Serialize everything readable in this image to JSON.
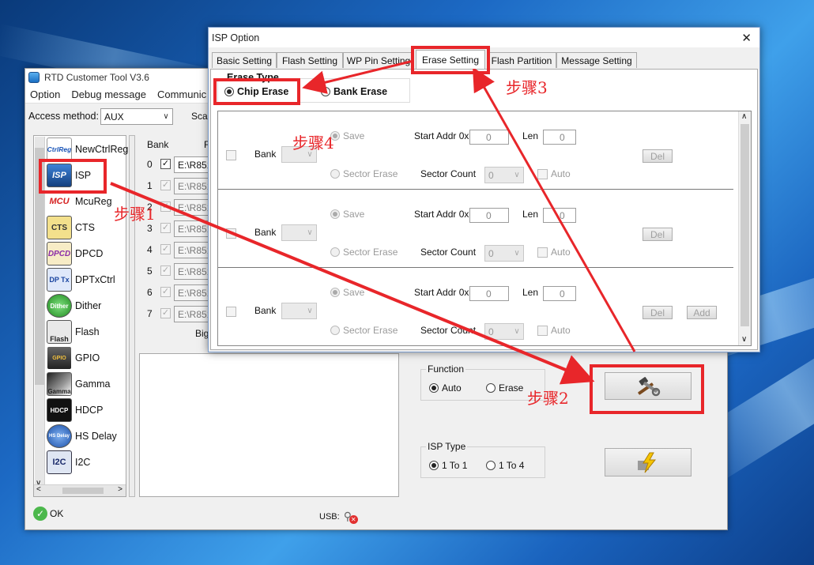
{
  "desktop": {
    "accent": "#1c69c4"
  },
  "main": {
    "title": "RTD Customer Tool V3.6",
    "menu": [
      "Option",
      "Debug message",
      "Communic"
    ],
    "access_label": "Access method:",
    "access_value": "AUX",
    "scan_label": "Sca",
    "sidebar": [
      {
        "label": "NewCtrlReg",
        "icon": "CtrlReg"
      },
      {
        "label": "ISP",
        "icon": "ISP"
      },
      {
        "label": "McuReg",
        "icon": "MCU"
      },
      {
        "label": "CTS",
        "icon": "CTS"
      },
      {
        "label": "DPCD",
        "icon": "DPCD"
      },
      {
        "label": "DPTxCtrl",
        "icon": "DP Tx"
      },
      {
        "label": "Dither",
        "icon": "Dither"
      },
      {
        "label": "Flash",
        "icon": "Flash"
      },
      {
        "label": "GPIO",
        "icon": "GPIO"
      },
      {
        "label": "Gamma",
        "icon": "Gamma"
      },
      {
        "label": "HDCP",
        "icon": "HDCP"
      },
      {
        "label": "HS Delay",
        "icon": "HS Delay"
      },
      {
        "label": "I2C",
        "icon": "I2C"
      }
    ],
    "bank_header": "Bank",
    "bank_header2": "F",
    "banks": [
      {
        "num": "0",
        "path": "E:\\R851"
      },
      {
        "num": "1",
        "path": "E:\\R851"
      },
      {
        "num": "2",
        "path": "E:\\R851"
      },
      {
        "num": "3",
        "path": "E:\\R851"
      },
      {
        "num": "4",
        "path": "E:\\R851"
      },
      {
        "num": "5",
        "path": "E:\\R851"
      },
      {
        "num": "6",
        "path": "E:\\R851"
      },
      {
        "num": "7",
        "path": "E:\\R851"
      }
    ],
    "big_label": "Big",
    "function": {
      "title": "Function",
      "opt1": "Auto",
      "opt2": "Erase"
    },
    "isp_type": {
      "title": "ISP Type",
      "opt1": "1 To 1",
      "opt2": "1 To 4"
    },
    "status_ok": "OK",
    "usb_label": "USB:"
  },
  "dialog": {
    "title": "ISP Option",
    "tabs": [
      "Basic Setting",
      "Flash Setting",
      "WP Pin Setting",
      "Erase Setting",
      "Flash Partition",
      "Message Setting"
    ],
    "erase_type_label": "Erase Type",
    "chip_erase": "Chip Erase",
    "bank_erase": "Bank Erase",
    "row": {
      "bank": "Bank",
      "save": "Save",
      "sector_erase": "Sector Erase",
      "start_addr": "Start Addr 0x",
      "len": "Len",
      "sector_count": "Sector Count",
      "auto": "Auto",
      "del": "Del",
      "add": "Add",
      "addr_value": "0",
      "len_value": "0",
      "count_value": "0"
    }
  },
  "annotations": {
    "step1": "步骤1",
    "step2": "步骤2",
    "step3": "步骤3",
    "step4": "步骤4",
    "color": "#e8262a"
  }
}
